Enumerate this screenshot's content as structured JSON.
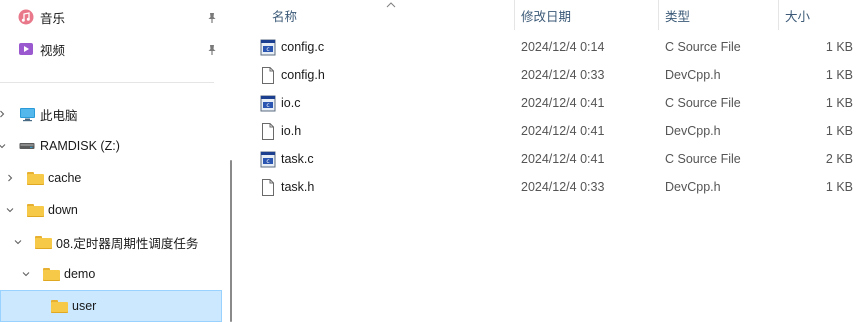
{
  "nav": {
    "items": [
      {
        "label": "音乐",
        "icon": "music-icon",
        "pinned": true
      },
      {
        "label": "视频",
        "icon": "video-icon",
        "pinned": true
      },
      {
        "label": "此电脑",
        "icon": "computer-icon",
        "expanded": false
      },
      {
        "label": "RAMDISK (Z:)",
        "icon": "drive-icon",
        "expanded": true
      },
      {
        "label": "cache",
        "icon": "folder-icon",
        "expanded": false
      },
      {
        "label": "down",
        "icon": "folder-icon",
        "expanded": true
      },
      {
        "label": "08.定时器周期性调度任务",
        "icon": "folder-icon",
        "expanded": true
      },
      {
        "label": "demo",
        "icon": "folder-icon",
        "expanded": true
      },
      {
        "label": "user",
        "icon": "folder-icon",
        "selected": true
      }
    ]
  },
  "columns": {
    "name": "名称",
    "date": "修改日期",
    "type": "类型",
    "size": "大小"
  },
  "files": [
    {
      "name": "config.c",
      "date": "2024/12/4 0:14",
      "type": "C Source File",
      "size": "1 KB",
      "icon": "c-source-icon"
    },
    {
      "name": "config.h",
      "date": "2024/12/4 0:33",
      "type": "DevCpp.h",
      "size": "1 KB",
      "icon": "header-file-icon"
    },
    {
      "name": "io.c",
      "date": "2024/12/4 0:41",
      "type": "C Source File",
      "size": "1 KB",
      "icon": "c-source-icon"
    },
    {
      "name": "io.h",
      "date": "2024/12/4 0:41",
      "type": "DevCpp.h",
      "size": "1 KB",
      "icon": "header-file-icon"
    },
    {
      "name": "task.c",
      "date": "2024/12/4 0:41",
      "type": "C Source File",
      "size": "2 KB",
      "icon": "c-source-icon"
    },
    {
      "name": "task.h",
      "date": "2024/12/4 0:33",
      "type": "DevCpp.h",
      "size": "1 KB",
      "icon": "header-file-icon"
    }
  ],
  "colors": {
    "selection": "#cce8ff",
    "selection_border": "#99d1ff",
    "folder": "#f7c948",
    "header_text": "#3c5a78"
  }
}
